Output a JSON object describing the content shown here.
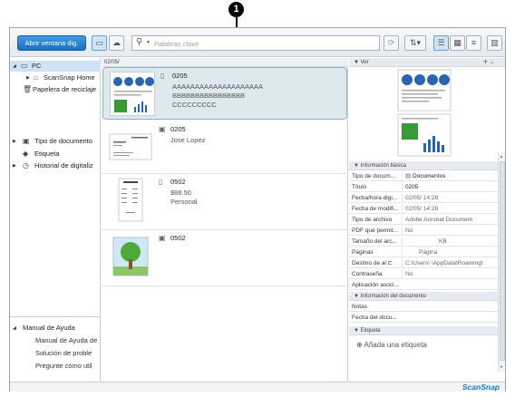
{
  "callout": {
    "number": "1"
  },
  "toolbar": {
    "open_scan_window_label": "Abrir ventana dig.",
    "search_placeholder": "Palabras clave",
    "icons": [
      "scan-to-pc-icon",
      "cloud-icon",
      "search-icon",
      "refresh-icon",
      "sort-icon",
      "list-view-icon",
      "thumbnail-view-icon",
      "detail-view-icon",
      "panel-toggle-icon"
    ]
  },
  "sidebar": {
    "items": [
      {
        "label": "PC",
        "icon": "monitor-icon",
        "selected": true
      },
      {
        "label": "ScanSnap Home",
        "icon": "home-icon"
      },
      {
        "label": "Papelera de reciclaje",
        "icon": "trash-icon"
      },
      {
        "label": "Tipo de documento",
        "icon": "document-type-icon"
      },
      {
        "label": "Etiqueta",
        "icon": "tag-icon"
      },
      {
        "label": "Historial de digitaliz",
        "icon": "history-icon"
      }
    ],
    "help": {
      "title": "Manual de Ayuda",
      "items": [
        "Manual de Ayuda de",
        "Solución de proble",
        "Pregunte cómo util"
      ]
    }
  },
  "content": {
    "date_header": "02/05/",
    "records": [
      {
        "name": "0205",
        "line2": "AAAAAAAAAAAAAAAAAAAA",
        "line3": "BBBBBBBBBBBBBBBB",
        "line4": "CCCCCCCCC",
        "selected": true,
        "thumb": "document"
      },
      {
        "name": "0205",
        "line2": "Jose Lopez",
        "line3": "",
        "line4": "",
        "thumb": "business-card"
      },
      {
        "name": "0502",
        "line2": "$88.50",
        "line3": "Personal",
        "line4": "",
        "thumb": "receipt"
      },
      {
        "name": "0502",
        "line2": "",
        "line3": "",
        "line4": "",
        "thumb": "photo"
      }
    ]
  },
  "viewer": {
    "header": "Ver",
    "info_header": "Información básica",
    "info_rows": [
      {
        "key": "Tipo de docum...",
        "value": "Documentos"
      },
      {
        "key": "Título",
        "value": "0205"
      },
      {
        "key": "Fecha/hora digi...",
        "value": "02/05/      14:28"
      },
      {
        "key": "Fecha de modifi...",
        "value": "02/05/      14:28"
      },
      {
        "key": "Tipo de archivo",
        "value": "Adobe Acrobat Document"
      },
      {
        "key": "PDF que permit...",
        "value": "No"
      },
      {
        "key": "Tamaño del arc...",
        "value": "KB"
      },
      {
        "key": "Páginas",
        "value": "Página"
      },
      {
        "key": "Destino de al",
        "value": "C:\\Users\\   \\AppData\\Roaming\\"
      },
      {
        "key": "Contraseña",
        "value": "No"
      },
      {
        "key": "Aplicación asoci...",
        "value": ""
      }
    ],
    "doc_info_header": "Información del documento",
    "doc_info_rows": [
      {
        "key": "Notas",
        "value": ""
      },
      {
        "key": "Fecha del docu...",
        "value": ""
      }
    ],
    "tag_header": "Etiqueta",
    "add_tag_label": "Añada una etiqueta"
  },
  "statusbar": {
    "brand": "ScanSnap"
  },
  "colors": {
    "accent": "#1f6fbf",
    "selection": "#dde9ee",
    "brand": "#1d78c7"
  }
}
